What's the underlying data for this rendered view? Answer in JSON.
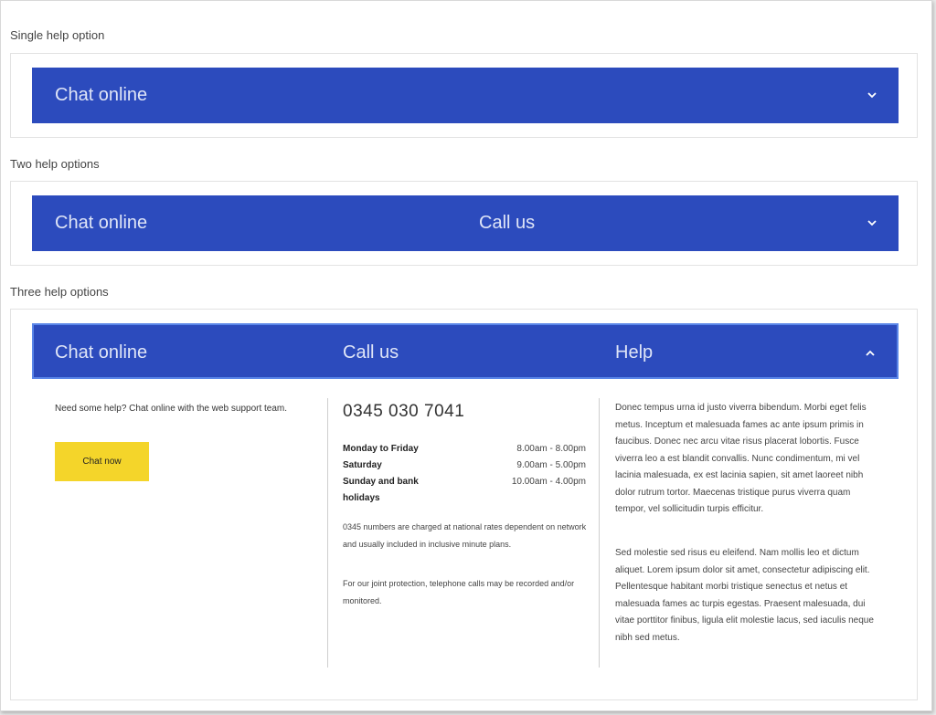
{
  "sections": {
    "single": {
      "label": "Single help option",
      "options": [
        "Chat online"
      ]
    },
    "two": {
      "label": "Two help options",
      "options": [
        "Chat online",
        "Call us"
      ]
    },
    "three": {
      "label": "Three help options",
      "options": [
        "Chat online",
        "Call us",
        "Help"
      ],
      "chat": {
        "text": "Need some help? Chat online with the web support team.",
        "button": "Chat now",
        "button_color": "#f4d52a"
      },
      "call": {
        "phone": "0345 030 7041",
        "hours": [
          {
            "day": "Monday to Friday",
            "time": "8.00am - 8.00pm"
          },
          {
            "day": "Saturday",
            "time": "9.00am - 5.00pm"
          },
          {
            "day": "Sunday and bank holidays",
            "time": "10.00am - 4.00pm"
          }
        ],
        "note1": "0345 numbers are charged at national rates dependent on network and usually included in inclusive minute plans.",
        "note2": "For our joint protection, telephone calls may be recorded and/or monitored."
      },
      "help": {
        "para1": "Donec tempus urna id justo viverra bibendum. Morbi eget felis metus. Inceptum et malesuada fames ac ante ipsum primis in faucibus. Donec nec arcu vitae risus placerat lobortis. Fusce viverra leo a est blandit convallis. Nunc condimentum, mi vel lacinia malesuada, ex est lacinia sapien, sit amet laoreet nibh dolor rutrum tortor. Maecenas tristique purus viverra quam tempor, vel sollicitudin turpis efficitur.",
        "para2": "Sed molestie sed risus eu eleifend. Nam mollis leo et dictum aliquet. Lorem ipsum dolor sit amet, consectetur adipiscing elit. Pellentesque habitant morbi tristique senectus et netus et malesuada fames ac turpis egestas. Praesent malesuada, dui vitae porttitor finibus, ligula elit molestie lacus, sed iaculis neque nibh sed metus."
      }
    }
  },
  "colors": {
    "bar": "#2c4bbd",
    "bar_text": "#dfe5f7",
    "chat_button": "#f4d52a"
  },
  "icons": {
    "collapsed": "chevron-down-icon",
    "expanded": "chevron-up-icon"
  }
}
